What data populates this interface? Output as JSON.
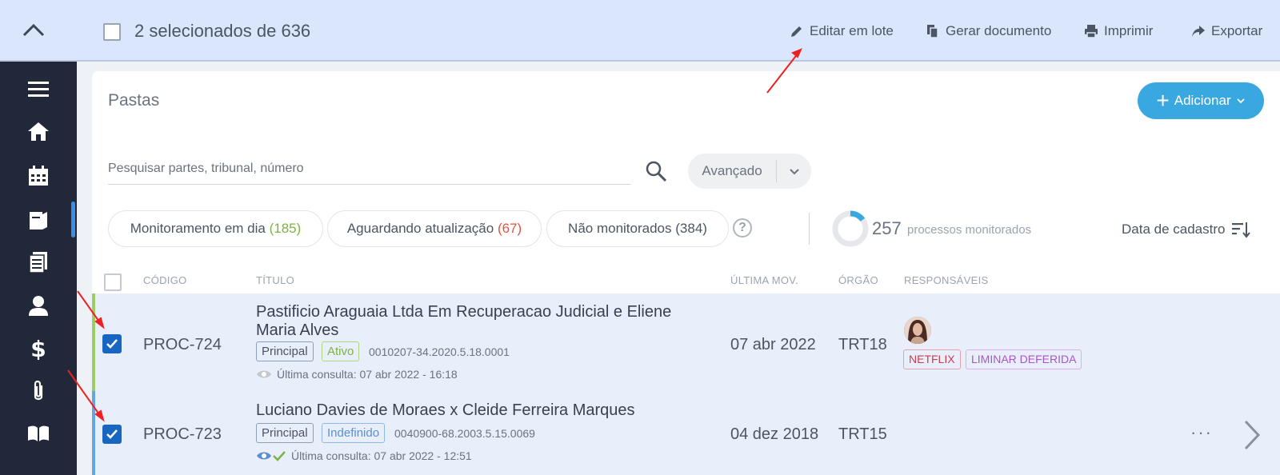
{
  "selection": {
    "text": "2 selecionados de 636"
  },
  "toolbar": {
    "edit_batch": "Editar em lote",
    "generate_doc": "Gerar documento",
    "print": "Imprimir",
    "export": "Exportar"
  },
  "page": {
    "title": "Pastas",
    "add_label": "Adicionar"
  },
  "search": {
    "placeholder": "Pesquisar partes, tribunal, número",
    "advanced_label": "Avançado"
  },
  "filters": [
    {
      "label": "Monitoramento em dia",
      "count": "(185)",
      "color": "#7cb342"
    },
    {
      "label": "Aguardando atualização",
      "count": "(67)",
      "color": "#e0533e"
    },
    {
      "label": "Não monitorados",
      "count": "(384)",
      "color": "#4b5563"
    }
  ],
  "monitoring": {
    "count": "257",
    "label": "processos monitorados",
    "fraction": 0.15
  },
  "sort": {
    "label": "Data de cadastro"
  },
  "columns": {
    "code": "CÓDIGO",
    "title": "TÍTULO",
    "last_mov": "ÚLTIMA MOV.",
    "org": "ÓRGÃO",
    "resp": "RESPONSÁVEIS"
  },
  "rows": [
    {
      "code": "PROC-724",
      "title_line1": "Pastificio Araguaia Ltda Em Recuperacao Judicial e Eliene",
      "title_line2": "Maria Alves",
      "tag1": "Principal",
      "tag2": "Ativo",
      "number": "0010207-34.2020.5.18.0001",
      "last_query": "Última consulta: 07 abr 2022 - 16:18",
      "date": "07 abr 2022",
      "org": "TRT18",
      "labels": [
        {
          "text": "NETFLIX",
          "color": "#d03a4e"
        },
        {
          "text": "LIMINAR DEFERIDA",
          "color": "#a855c7"
        }
      ],
      "checked": true
    },
    {
      "code": "PROC-723",
      "title_line1": "Luciano Davies de Moraes x Cleide Ferreira Marques",
      "tag1": "Principal",
      "tag2": "Indefinido",
      "number": "0040900-68.2003.5.15.0069",
      "last_query": "Última consulta: 07 abr 2022 - 12:51",
      "date": "04 dez 2018",
      "org": "TRT15",
      "checked": true
    }
  ],
  "more": "···",
  "icons": [
    "chevron-up-icon",
    "menu-icon",
    "home-icon",
    "calendar-icon",
    "folder-icon",
    "documents-icon",
    "person-icon",
    "dollar-icon",
    "paperclip-icon",
    "book-icon",
    "search-icon",
    "pencil-icon",
    "copy-icon",
    "printer-icon",
    "share-icon",
    "sort-icon",
    "eye-icon",
    "check-icon",
    "chevron-right-icon"
  ]
}
